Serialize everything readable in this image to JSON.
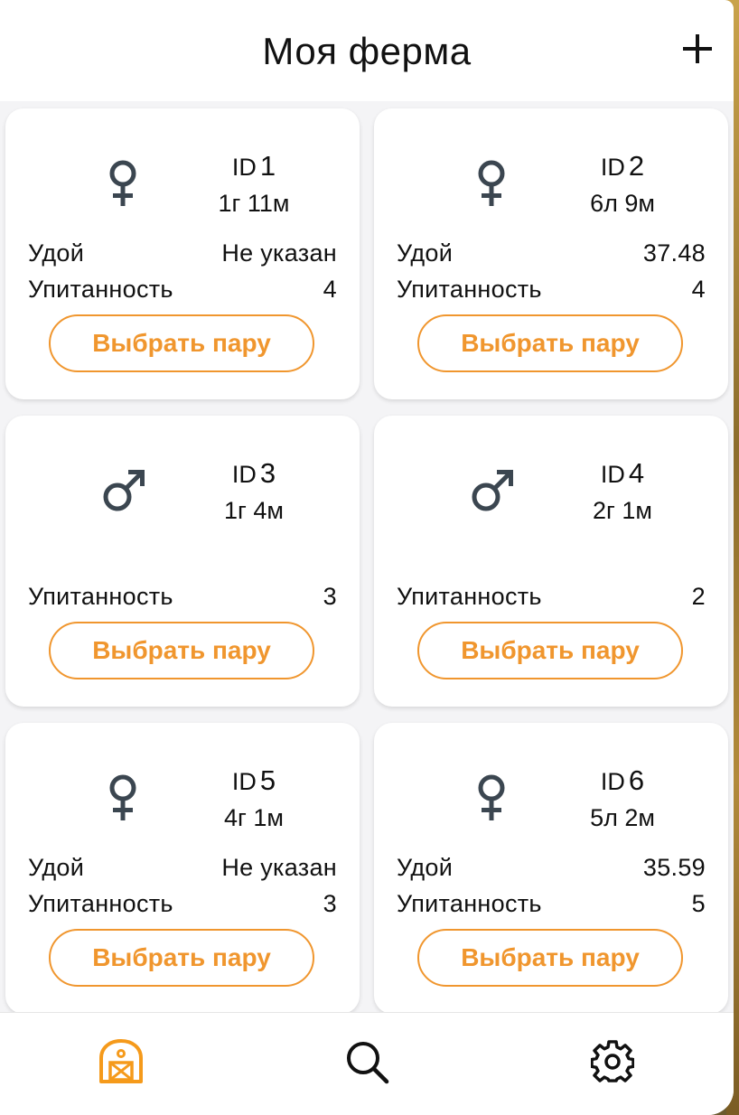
{
  "header": {
    "title": "Моя ферма"
  },
  "animals": [
    {
      "id_prefix": "ID",
      "id": "1",
      "sex": "female",
      "age": "1г 11м",
      "rows": [
        {
          "label": "Удой",
          "value": "Не указан"
        },
        {
          "label": "Упитанность",
          "value": "4"
        }
      ],
      "button": "Выбрать пару"
    },
    {
      "id_prefix": "ID",
      "id": "2",
      "sex": "female",
      "age": "6л 9м",
      "rows": [
        {
          "label": "Удой",
          "value": "37.48"
        },
        {
          "label": "Упитанность",
          "value": "4"
        }
      ],
      "button": "Выбрать пару"
    },
    {
      "id_prefix": "ID",
      "id": "3",
      "sex": "male",
      "age": "1г 4м",
      "rows": [
        {
          "label": "Упитанность",
          "value": "3"
        }
      ],
      "button": "Выбрать пару"
    },
    {
      "id_prefix": "ID",
      "id": "4",
      "sex": "male",
      "age": "2г 1м",
      "rows": [
        {
          "label": "Упитанность",
          "value": "2"
        }
      ],
      "button": "Выбрать пару"
    },
    {
      "id_prefix": "ID",
      "id": "5",
      "sex": "female",
      "age": "4г 1м",
      "rows": [
        {
          "label": "Удой",
          "value": "Не указан"
        },
        {
          "label": "Упитанность",
          "value": "3"
        }
      ],
      "button": "Выбрать пару"
    },
    {
      "id_prefix": "ID",
      "id": "6",
      "sex": "female",
      "age": "5л 2м",
      "rows": [
        {
          "label": "Удой",
          "value": "35.59"
        },
        {
          "label": "Упитанность",
          "value": "5"
        }
      ],
      "button": "Выбрать пару"
    }
  ],
  "icons": {
    "add": "plus-icon",
    "female": "female-sign-icon",
    "male": "male-sign-icon",
    "tab_farm": "barn-icon",
    "tab_search": "search-icon",
    "tab_settings": "gear-icon"
  },
  "colors": {
    "accent": "#f0962e",
    "icon_dark": "#3b4650",
    "background": "#f4f4f6"
  }
}
